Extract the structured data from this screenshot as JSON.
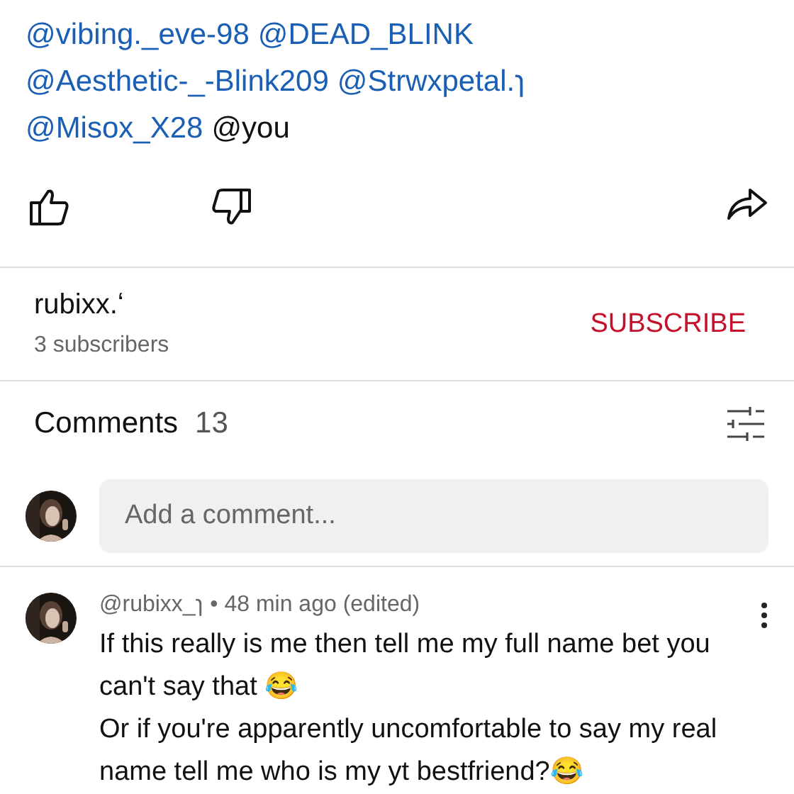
{
  "mention_lines": [
    [
      {
        "text": "@vibing._eve-98",
        "kind": "mention"
      },
      {
        "text": "@DEAD_BLINK",
        "kind": "mention"
      }
    ],
    [
      {
        "text": "@Aesthetic-_-Blink209",
        "kind": "mention"
      },
      {
        "text": "@Strwxpetal.ɿ",
        "kind": "mention"
      }
    ],
    [
      {
        "text": "@Misox_X28",
        "kind": "mention"
      },
      {
        "text": "@you",
        "kind": "plain"
      }
    ]
  ],
  "actions": [
    {
      "kind": "like"
    },
    {
      "kind": "dislike"
    },
    {
      "kind": "share"
    }
  ],
  "channel": {
    "name": "rubixx.ʻ",
    "subscribers": "3 subscribers",
    "button": "SUBSCRIBE"
  },
  "comments_header": {
    "title": "Comments",
    "count": "13"
  },
  "add_comment": {
    "placeholder": "Add a comment..."
  },
  "comments": [
    {
      "author": "@rubixx_ɿ",
      "meta": "• 48 min ago (edited)",
      "text": "If this really is me then tell me my full name bet you can't say that 😂\nOr if you're apparently uncomfortable to say my real name tell me who is my yt bestfriend?😂"
    }
  ]
}
